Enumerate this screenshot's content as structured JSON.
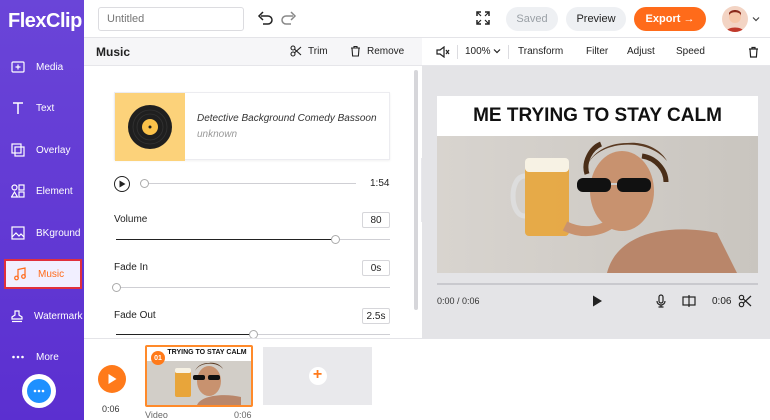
{
  "app": {
    "logo": "FlexClip"
  },
  "sidebar": {
    "items": [
      {
        "label": "Media",
        "icon": "media-plus-icon"
      },
      {
        "label": "Text",
        "icon": "text-t-icon"
      },
      {
        "label": "Overlay",
        "icon": "overlay-icon"
      },
      {
        "label": "Element",
        "icon": "element-shapes-icon"
      },
      {
        "label": "BKground",
        "icon": "background-icon"
      },
      {
        "label": "Music",
        "icon": "music-note-icon",
        "active": true
      },
      {
        "label": "Watermark",
        "icon": "watermark-stamp-icon"
      },
      {
        "label": "More",
        "icon": "more-dots-icon"
      }
    ]
  },
  "topbar": {
    "title_placeholder": "Untitled",
    "saved_label": "Saved",
    "preview_label": "Preview",
    "export_label": "Export →"
  },
  "music_panel": {
    "title": "Music",
    "trim_label": "Trim",
    "remove_label": "Remove",
    "track": {
      "title": "Detective Background Comedy Bassoon",
      "artist": "unknown",
      "duration": "1:54",
      "position": 0
    },
    "volume": {
      "label": "Volume",
      "value": "80",
      "fraction": 0.8
    },
    "fade_in": {
      "label": "Fade In",
      "value": "0s",
      "fraction": 0
    },
    "fade_out": {
      "label": "Fade Out",
      "value": "2.5s",
      "fraction": 0.5
    }
  },
  "preview": {
    "zoom": "100%",
    "tools": [
      "Transform",
      "Filter",
      "Adjust",
      "Speed"
    ],
    "caption": "ME TRYING TO STAY CALM",
    "time": "0:00 / 0:06",
    "duration": "0:06"
  },
  "timeline": {
    "time": "0:06",
    "clip": {
      "number": "01",
      "caption": "TRYING TO STAY CALM",
      "type": "Video",
      "duration": "0:06"
    }
  },
  "colors": {
    "accent": "#ff6b1a",
    "sidebar": "#5b2fd0",
    "chat": "#1e90ff"
  }
}
